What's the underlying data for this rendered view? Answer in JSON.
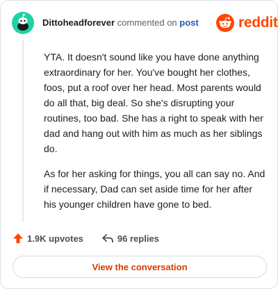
{
  "header": {
    "author": "Dittoheadforever",
    "action": "commented on",
    "target": "post",
    "brand": "reddit"
  },
  "comment": {
    "paragraphs": [
      "YTA. It doesn't sound like you have done anything extraordinary for her. You've bought her clothes, foos, put a roof over her head. Most parents would do all that, big deal. So she's disrupting your routines, too bad. She has a right to speak with her dad and hang out with him as much as her siblings do.",
      "As for her asking for things, you all can say no. And if necessary, Dad can set aside time for her after his younger children have gone to bed."
    ]
  },
  "stats": {
    "upvotes": "1.9K upvotes",
    "replies": "96 replies"
  },
  "cta": {
    "label": "View the conversation"
  },
  "colors": {
    "brand": "#ff4500",
    "avatar": "#1fd1a3",
    "post_link": "#1a5fb4",
    "cta_text": "#d93a00"
  },
  "icons": {
    "avatar": "reddit-snoo-avatar-icon",
    "logo": "reddit-logo-icon",
    "upvote": "upvote-arrow-icon",
    "reply": "reply-arrow-icon"
  }
}
